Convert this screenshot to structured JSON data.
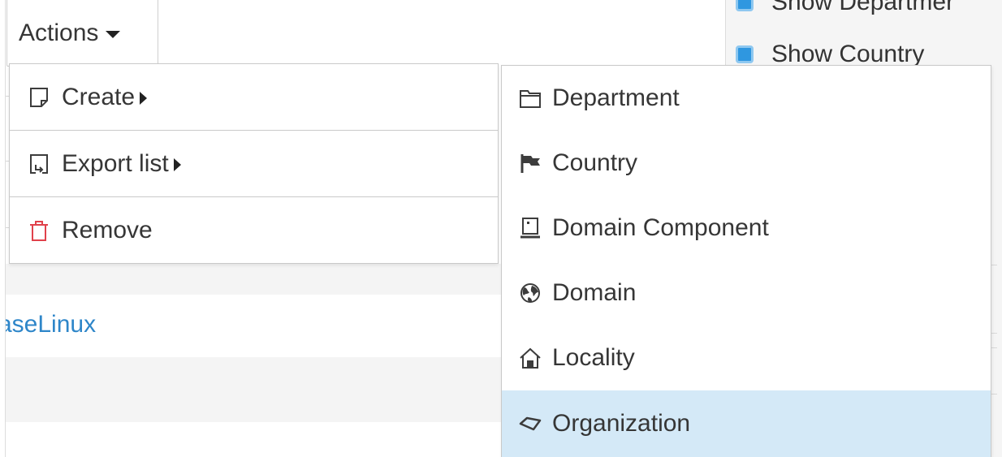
{
  "toolbar": {
    "actions_label": "Actions"
  },
  "actions_menu": {
    "items": [
      {
        "label": "Create",
        "icon": "create-icon",
        "has_submenu": true
      },
      {
        "label": "Export list",
        "icon": "export-icon",
        "has_submenu": true
      },
      {
        "label": "Remove",
        "icon": "trash-icon",
        "has_submenu": false,
        "icon_color": "#e0414b"
      }
    ]
  },
  "create_submenu": {
    "items": [
      {
        "label": "Department",
        "icon": "folder-icon"
      },
      {
        "label": "Country",
        "icon": "flag-icon"
      },
      {
        "label": "Domain Component",
        "icon": "computer-icon"
      },
      {
        "label": "Domain",
        "icon": "globe-icon"
      },
      {
        "label": "Locality",
        "icon": "house-icon"
      },
      {
        "label": "Organization",
        "icon": "organization-icon",
        "highlighted": true
      }
    ],
    "highlight_color": "#d4e9f7"
  },
  "list": {
    "link_text": "aseLinux",
    "link_color": "#2e86c9"
  },
  "display_options": {
    "items": [
      {
        "label": "Show Departmer",
        "checked": true
      },
      {
        "label": "Show Country",
        "checked": true
      }
    ],
    "checkbox_color": "#2f97e0"
  }
}
